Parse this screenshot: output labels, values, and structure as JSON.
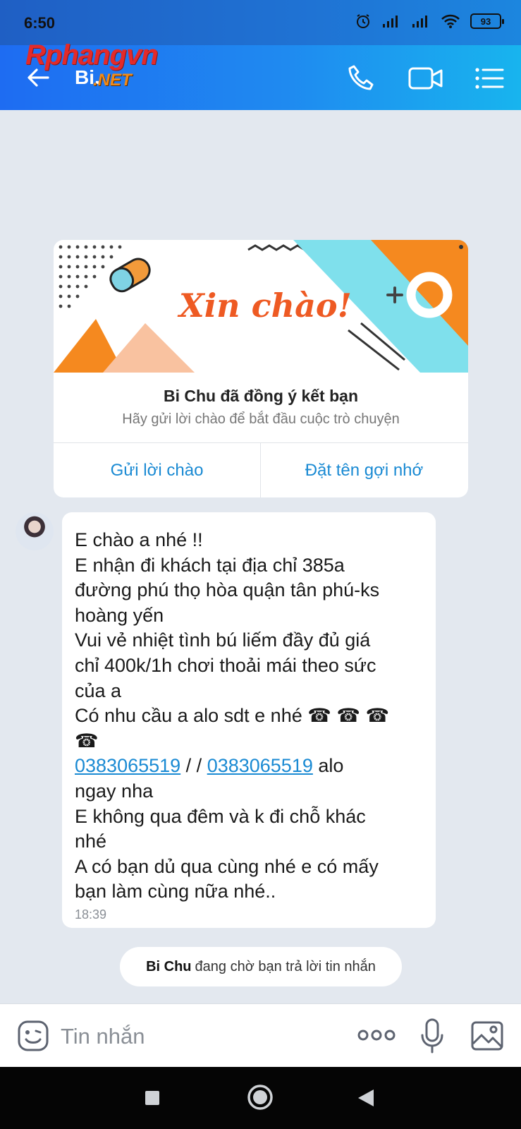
{
  "status": {
    "time": "6:50",
    "battery": "93",
    "icons": [
      "alarm-icon",
      "signal-icon",
      "signal-icon",
      "wifi-icon",
      "battery-icon"
    ]
  },
  "header": {
    "title": "Bi.",
    "watermark_main": "Rphangvn",
    "watermark_sub": ".NET",
    "icons": [
      "back-arrow-icon",
      "phone-icon",
      "video-icon",
      "menu-icon"
    ]
  },
  "card": {
    "banner_text": "Xin chào!",
    "title": "Bi Chu đã đồng ý kết bạn",
    "subtitle": "Hãy gửi lời chào để bắt đầu cuộc trò chuyện",
    "button_left": "Gửi lời chào",
    "button_right": "Đặt tên gợi nhớ"
  },
  "message": {
    "lines": [
      "E chào a nhé !!",
      "E nhận đi khách tại địa chỉ 385a",
      "đường phú thọ hòa quận tân phú-ks",
      "hoàng yến",
      "Vui vẻ nhiệt tình bú liếm đầy đủ giá",
      "chỉ 400k/1h chơi thoải mái theo sức",
      "của a",
      "Có nhu cầu a alo sdt e nhé ☎ ☎ ☎",
      "☎"
    ],
    "phone_1": "0383065519",
    "separator": " / / ",
    "phone_2": "0383065519",
    "after_phone": " alo",
    "lines_after": [
      "ngay nha",
      "E không qua đêm và k đi chỗ khác",
      "nhé",
      "A có bạn dủ qua cùng nhé e có mấy",
      "bạn làm cùng nữa nhé.."
    ],
    "time": "18:39"
  },
  "waiting": {
    "name": "Bi Chu",
    "text": "đang chờ bạn trả lời tin nhắn"
  },
  "input": {
    "placeholder": "Tin nhắn",
    "value": ""
  },
  "colors": {
    "header_start": "#1e6cf2",
    "header_end": "#18b4ee",
    "link": "#1a8ad3",
    "background": "#e3e8ef"
  }
}
